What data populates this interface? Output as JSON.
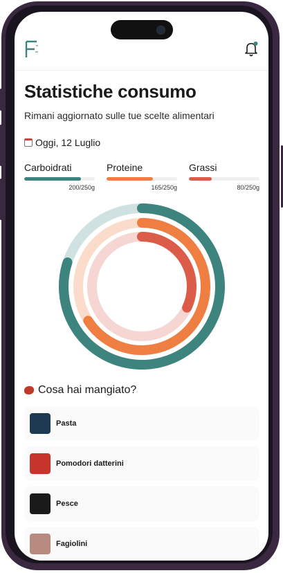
{
  "header": {
    "logo_icon": "brand-f-logo",
    "notification_icon": "bell-icon"
  },
  "page": {
    "title": "Statistiche consumo",
    "subtitle": "Rimani aggiornato sulle tue scelte alimentari",
    "date_icon": "calendar-icon",
    "date": "Oggi, 12 Luglio"
  },
  "macros": [
    {
      "label": "Carboidrati",
      "value": "200/250g",
      "consumed": 200,
      "target": 250,
      "color": "#3d847f",
      "track_color": "#cfe2e1"
    },
    {
      "label": "Proteine",
      "value": "165/250g",
      "consumed": 165,
      "target": 250,
      "color": "#ef7e42",
      "track_color": "#fbdccb"
    },
    {
      "label": "Grassi",
      "value": "80/250g",
      "consumed": 80,
      "target": 250,
      "color": "#db5d49",
      "track_color": "#f6d6d2"
    }
  ],
  "meals": {
    "title": "Cosa hai mangiato?",
    "title_icon": "steak-icon",
    "items": [
      {
        "name": "Pasta",
        "thumb": "pasta-thumbnail",
        "color": "#1d3a52"
      },
      {
        "name": "Pomodori datterini",
        "thumb": "tomatoes-thumbnail",
        "color": "#c7342b"
      },
      {
        "name": "Pesce",
        "thumb": "fish-thumbnail",
        "color": "#1a1a1a"
      },
      {
        "name": "Fagiolini",
        "thumb": "beans-thumbnail",
        "color": "#b88a7f"
      }
    ]
  }
}
